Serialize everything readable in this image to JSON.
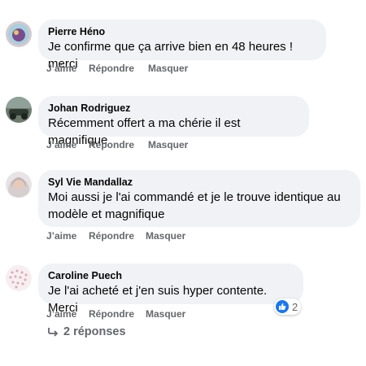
{
  "comments": [
    {
      "author": "Pierre Héno",
      "text": "Je confirme que ça arrive bien en 48 heures ! merci",
      "actions": [
        "J’aime",
        "Répondre",
        "Masquer"
      ]
    },
    {
      "author": "Johan Rodriguez",
      "text": "Récemment offert a ma chérie il est magnifique",
      "actions": [
        "J’aime",
        "Répondre",
        "Masquer"
      ]
    },
    {
      "author": "Syl Vie Mandallaz",
      "text_line1": "Moi aussi je l'ai commandé et je le trouve identique au",
      "text_line2": "modèle et magnifique",
      "actions": [
        "J’aime",
        "Répondre",
        "Masquer"
      ]
    },
    {
      "author": "Caroline Puech",
      "text": "Je l'ai acheté et j'en suis hyper contente. Merci",
      "actions": [
        "J’aime",
        "Répondre",
        "Masquer"
      ],
      "reaction": {
        "icon": "like-icon",
        "count": "2"
      }
    }
  ],
  "replies_link": {
    "label": "2 réponses",
    "icon": "reply-arrow-icon"
  },
  "colors": {
    "bubble": "#f0f2f5",
    "meta": "#65676b",
    "like_blue": "#1877f2"
  }
}
